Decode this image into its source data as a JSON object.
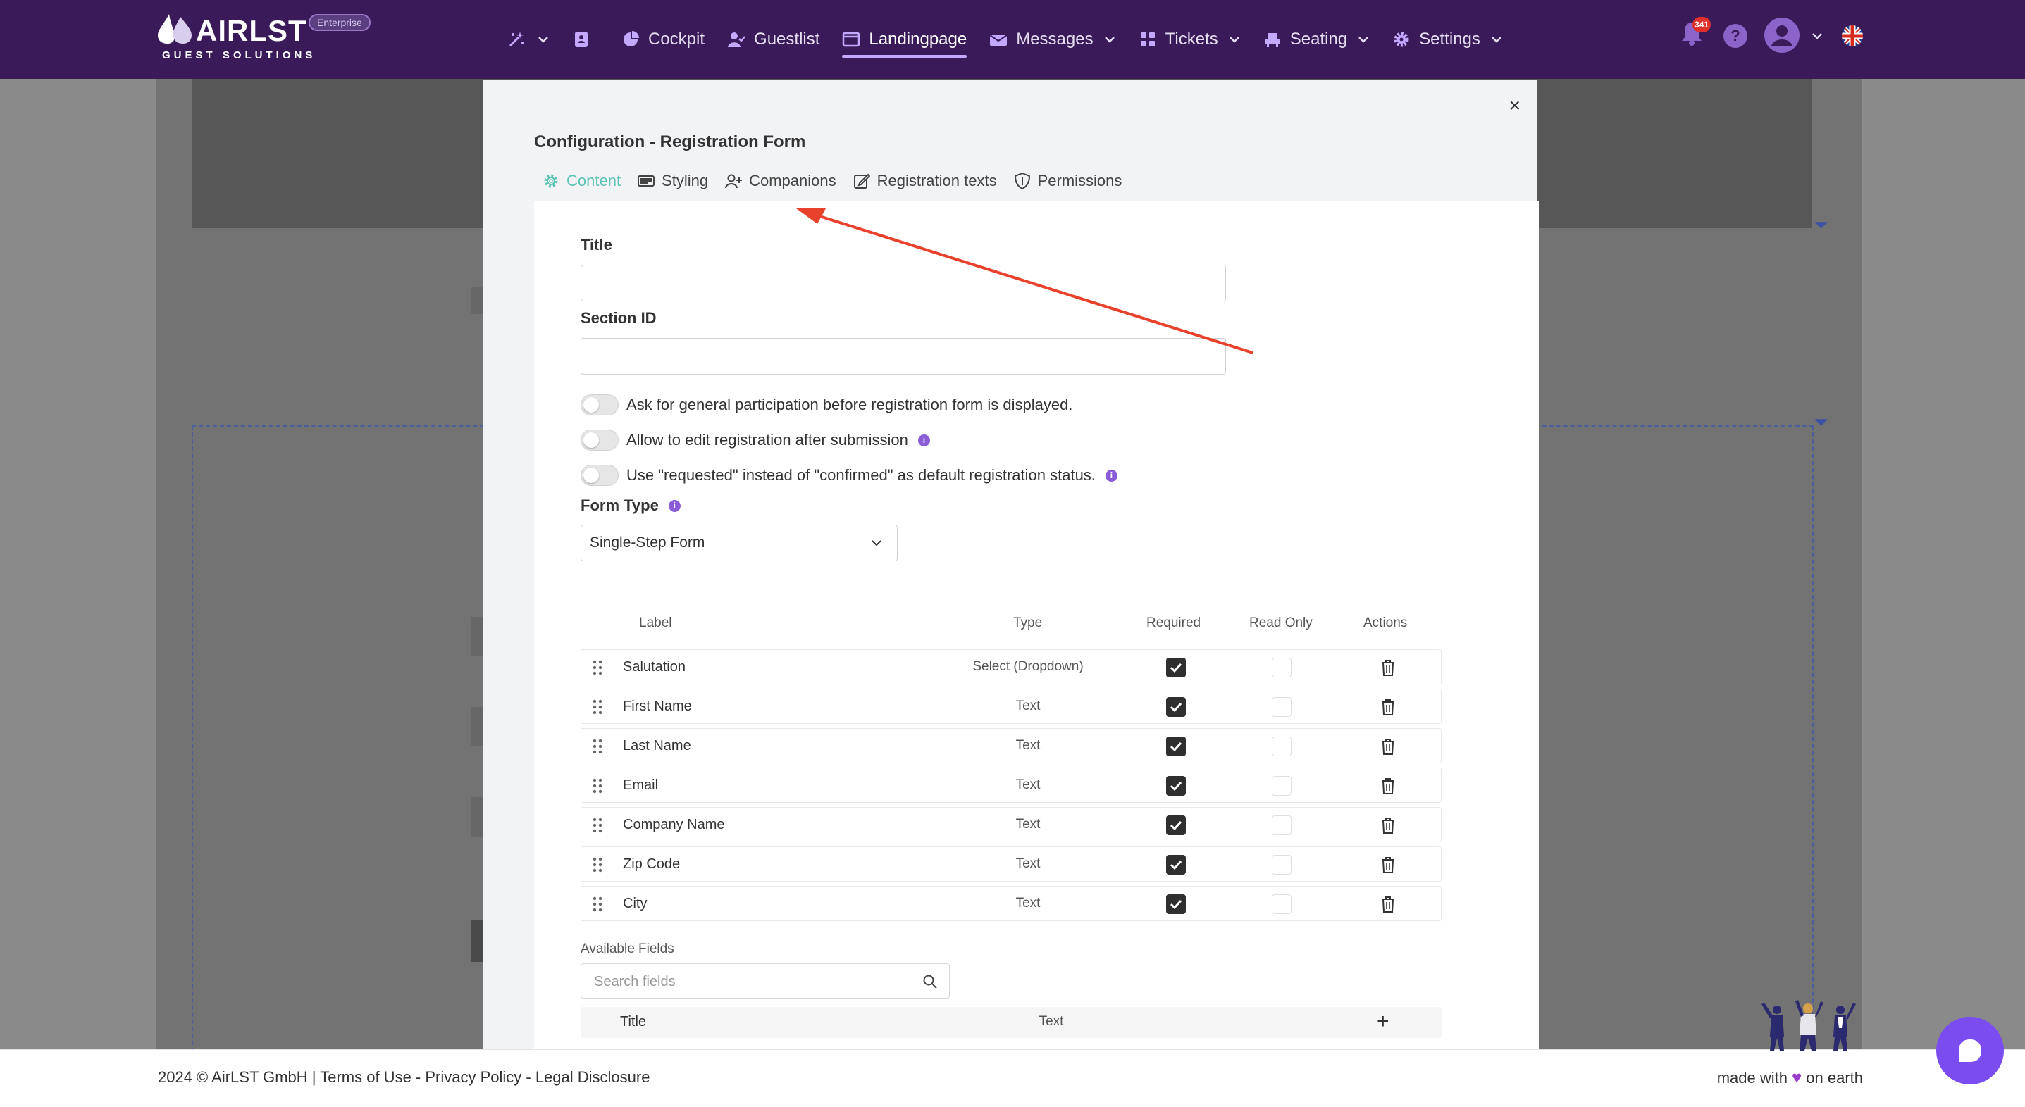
{
  "brand": {
    "name": "AIRLST",
    "sub": "GUEST SOLUTIONS",
    "badge": "Enterprise"
  },
  "nav": {
    "items": [
      {
        "label": "Cockpit",
        "icon": "pie-chart-icon"
      },
      {
        "label": "Guestlist",
        "icon": "user-check-icon"
      },
      {
        "label": "Landingpage",
        "icon": "browser-window-icon",
        "active": true
      },
      {
        "label": "Messages",
        "icon": "envelope-icon"
      },
      {
        "label": "Tickets",
        "icon": "grid-icon"
      },
      {
        "label": "Seating",
        "icon": "armchair-icon"
      },
      {
        "label": "Settings",
        "icon": "gear-icon"
      }
    ],
    "notification_count": "341",
    "help": "?"
  },
  "modal": {
    "close": "×",
    "title": "Configuration - Registration Form",
    "tabs": [
      {
        "label": "Content",
        "icon": "gear-icon",
        "active": true
      },
      {
        "label": "Styling",
        "icon": "palette-card-icon"
      },
      {
        "label": "Companions",
        "icon": "user-plus-icon"
      },
      {
        "label": "Registration texts",
        "icon": "edit-icon"
      },
      {
        "label": "Permissions",
        "icon": "shield-icon"
      }
    ],
    "fields": {
      "title_label": "Title",
      "title_value": "",
      "section_id_label": "Section ID",
      "section_id_value": ""
    },
    "toggles": [
      {
        "label": "Ask for general participation before registration form is displayed.",
        "on": false
      },
      {
        "label": "Allow to edit registration after submission",
        "on": false
      },
      {
        "label": "Use \"requested\" instead of \"confirmed\" as default registration status.",
        "on": false
      }
    ],
    "form_type": {
      "label": "Form Type",
      "value": "Single-Step Form"
    },
    "table": {
      "headers": {
        "label": "Label",
        "type": "Type",
        "required": "Required",
        "read_only": "Read Only",
        "actions": "Actions"
      },
      "rows": [
        {
          "label": "Salutation",
          "type": "Select (Dropdown)",
          "required": true,
          "read_only": false
        },
        {
          "label": "First Name",
          "type": "Text",
          "required": true,
          "read_only": false
        },
        {
          "label": "Last Name",
          "type": "Text",
          "required": true,
          "read_only": false
        },
        {
          "label": "Email",
          "type": "Text",
          "required": true,
          "read_only": false
        },
        {
          "label": "Company Name",
          "type": "Text",
          "required": true,
          "read_only": false
        },
        {
          "label": "Zip Code",
          "type": "Text",
          "required": true,
          "read_only": false
        },
        {
          "label": "City",
          "type": "Text",
          "required": true,
          "read_only": false
        }
      ]
    },
    "available": {
      "label": "Available Fields",
      "search_placeholder": "Search fields",
      "rows": [
        {
          "label": "Title",
          "type": "Text"
        }
      ]
    }
  },
  "footer": {
    "copyright": "2024 © AirLST GmbH | Terms of Use - Privacy Policy - Legal Disclosure",
    "made_with": "made with",
    "on_earth": "on earth"
  },
  "colors": {
    "navbar": "#3a1a58",
    "accent_tab": "#5cc4b4",
    "checkbox": "#2f2f2f",
    "annotation_arrow": "#e8412c",
    "chat": "#7b4cf0"
  }
}
